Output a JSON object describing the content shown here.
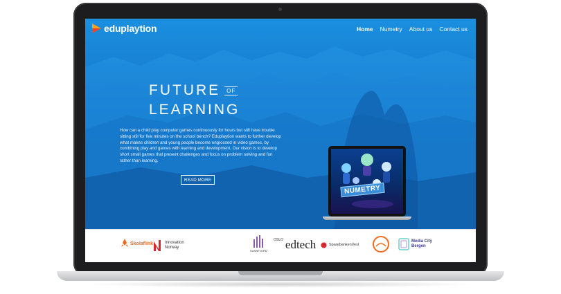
{
  "brand": {
    "name": "eduplaytion"
  },
  "nav": {
    "items": [
      "Home",
      "Numetry",
      "About us",
      "Contact us"
    ],
    "active": "Home"
  },
  "hero": {
    "title_line1": "FUTURE",
    "title_of": "OF",
    "title_line2": "LEARNING",
    "body": "How can a child play computer games continuously for hours but still have trouble sitting still for five minutes on the school bench? Eduplaytion wants to further develop what makes children and young people become engrossed in video games, by combining play and games with learning and development. Our vision is to develop short small games that present challenges and focus on problem solving and fun rather than learning.",
    "cta": "READ MORE",
    "game_logo": "NUMETRY"
  },
  "partners": {
    "skolaflink": "Skolaflink",
    "innovation_norway_1": "Innovation",
    "innovation_norway_2": "Norway",
    "sunnfjord": "SUNNFJORD",
    "oslo": "OSLO",
    "edtech": "edtech",
    "sparebanken": "SparebankenVest",
    "media_city_1": "Media City",
    "media_city_2": "Bergen"
  },
  "colors": {
    "hero_top": "#1b8fe0",
    "hero_bottom": "#0f5aa8",
    "accent_orange": "#f26a1b",
    "accent_red": "#d7282f"
  }
}
